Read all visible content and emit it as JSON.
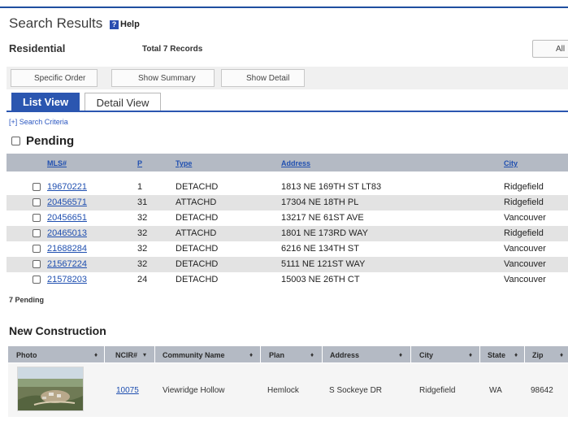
{
  "header": {
    "title": "Search Results",
    "help_label": "Help",
    "help_icon_glyph": "?"
  },
  "section": {
    "label": "Residential",
    "total_records": "Total 7 Records",
    "all_label": "All"
  },
  "toolbar": {
    "specific_order": "Specific Order",
    "show_summary": "Show Summary",
    "show_detail": "Show Detail"
  },
  "tabs": {
    "list_view": "List View",
    "detail_view": "Detail View"
  },
  "search_criteria": "[+] Search Criteria",
  "pending": {
    "title": "Pending",
    "columns": {
      "mls": "MLS#",
      "p": "P",
      "type": "Type",
      "address": "Address",
      "city": "City"
    },
    "rows": [
      {
        "mls": "19670221",
        "p": "1",
        "type": "DETACHD",
        "address": "1813 NE 169TH ST LT83",
        "city": "Ridgefield"
      },
      {
        "mls": "20456571",
        "p": "31",
        "type": "ATTACHD",
        "address": "17304 NE 18TH PL",
        "city": "Ridgefield"
      },
      {
        "mls": "20456651",
        "p": "32",
        "type": "DETACHD",
        "address": "13217 NE 61ST AVE",
        "city": "Vancouver"
      },
      {
        "mls": "20465013",
        "p": "32",
        "type": "ATTACHD",
        "address": "1801 NE 173RD WAY",
        "city": "Ridgefield"
      },
      {
        "mls": "21688284",
        "p": "32",
        "type": "DETACHD",
        "address": "6216 NE 134TH ST",
        "city": "Vancouver"
      },
      {
        "mls": "21567224",
        "p": "32",
        "type": "DETACHD",
        "address": "5111 NE 121ST WAY",
        "city": "Vancouver"
      },
      {
        "mls": "21578203",
        "p": "24",
        "type": "DETACHD",
        "address": "15003 NE 26TH CT",
        "city": "Vancouver"
      }
    ],
    "count_label": "7 Pending"
  },
  "new_construction": {
    "title": "New Construction",
    "columns": {
      "photo": "Photo",
      "ncir": "NCIR#",
      "community": "Community Name",
      "plan": "Plan",
      "address": "Address",
      "city": "City",
      "state": "State",
      "zip": "Zip"
    },
    "sort_glyph": "♦",
    "sort_desc_glyph": "▾",
    "row": {
      "ncir": "10075",
      "community": "Viewridge Hollow",
      "plan": "Hemlock",
      "address": "S Sockeye DR",
      "city": "Ridgefield",
      "state": "WA",
      "zip": "98642"
    }
  },
  "colors": {
    "accent_blue": "#2b56b0",
    "header_gray": "#b4bac4",
    "row_alt": "#e3e3e3",
    "link_blue": "#1f4fb0"
  }
}
